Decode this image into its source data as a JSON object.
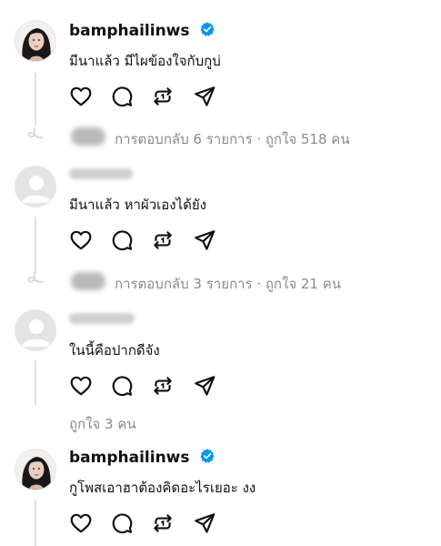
{
  "threads": [
    {
      "username": "bamphailinws",
      "verified": true,
      "text": "มีนาแล้ว มีไผข้องใจกับกูบ่",
      "replies_label": "การตอบกลับ 6 รายการ · ถูกใจ 518 คน"
    },
    {
      "username": "",
      "verified": false,
      "text": "มีนาแล้ว หาผัวเองได้ยัง",
      "replies_label": "การตอบกลับ 3 รายการ · ถูกใจ 21 คน"
    },
    {
      "username": "",
      "verified": false,
      "text": "ในนี้คือปากดีจัง",
      "likes_label": "ถูกใจ 3 คน"
    },
    {
      "username": "bamphailinws",
      "verified": true,
      "text": "กูโพสเอาฮาต้องคิดอะไรเยอะ งง"
    }
  ],
  "colors": {
    "verified": "#0095f6",
    "muted_text": "#8a8a8a",
    "thread_line": "#e1e1e1"
  },
  "icons": [
    "heart-icon",
    "comment-icon",
    "repost-icon",
    "share-icon",
    "verified-badge-icon",
    "reply-curl-icon"
  ]
}
